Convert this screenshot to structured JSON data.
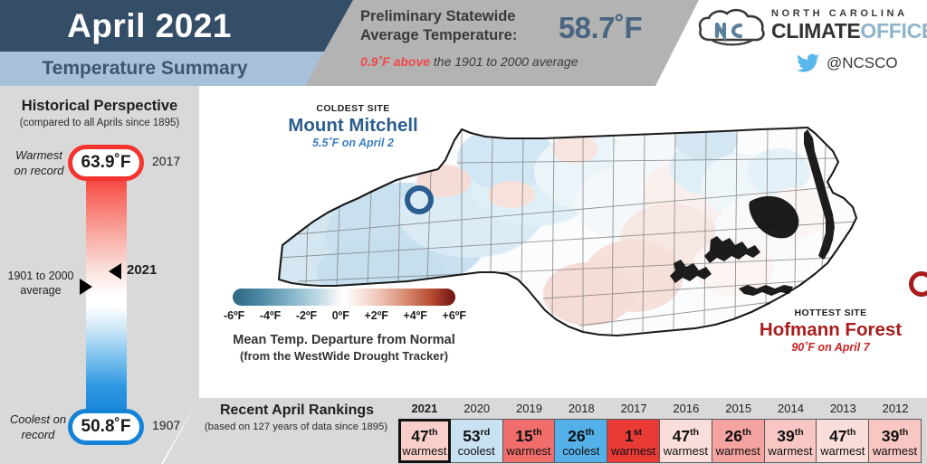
{
  "header": {
    "title": "April 2021",
    "subtitle": "Temperature Summary",
    "stat_label": "Preliminary Statewide Average Temperature:",
    "stat_value": "58.7˚F",
    "departure_value": "0.9˚F above",
    "departure_rest": " the 1901 to 2000 average"
  },
  "logo": {
    "org_line1": "NORTH CAROLINA",
    "org_part1": "CLIMATE",
    "org_part2": "OFFICE",
    "twitter_handle": "@NCSCO",
    "icon_cloud": "nc-cloud-logo-icon",
    "icon_twitter": "twitter-bird-icon"
  },
  "sidebar": {
    "title": "Historical Perspective",
    "subtitle": "(compared to all Aprils since 1895)",
    "warmest_label": "Warmest on record",
    "warmest_value": "63.9˚F",
    "warmest_year": "2017",
    "coolest_label": "Coolest on record",
    "coolest_value": "50.8˚F",
    "coolest_year": "1907",
    "average_label": "1901 to 2000 average",
    "current_marker": "2021",
    "hot_color": "#f4342f",
    "cold_color": "#1583d8"
  },
  "map": {
    "coldest_site": {
      "kind": "COLDEST SITE",
      "name": "Mount Mitchell",
      "value": "5.5˚F on April 2",
      "color": "#2b5e8e"
    },
    "hottest_site": {
      "kind": "HOTTEST SITE",
      "name": "Hofmann Forest",
      "value": "90˚F on April 7",
      "color": "#a81c1c"
    },
    "legend": {
      "ticks": [
        "-6ºF",
        "-4ºF",
        "-2ºF",
        "0ºF",
        "+2ºF",
        "+4ºF",
        "+6ºF"
      ],
      "caption_line1": "Mean Temp. Departure from Normal",
      "caption_line2": "(from the WestWide Drought Tracker)"
    }
  },
  "rankings": {
    "title": "Recent April Rankings",
    "subtitle": "(based on 127 years of data since 1895)",
    "items": [
      {
        "year": "2021",
        "rank": "47",
        "suffix": "th",
        "word": "warmest",
        "color": "#f9cfca",
        "current": true
      },
      {
        "year": "2020",
        "rank": "53",
        "suffix": "rd",
        "word": "coolest",
        "color": "#c9e2f2",
        "current": false
      },
      {
        "year": "2019",
        "rank": "15",
        "suffix": "th",
        "word": "warmest",
        "color": "#ef6e6c",
        "current": false
      },
      {
        "year": "2018",
        "rank": "26",
        "suffix": "th",
        "word": "coolest",
        "color": "#54b0e8",
        "current": false
      },
      {
        "year": "2017",
        "rank": "1",
        "suffix": "st",
        "word": "warmest",
        "color": "#ea3a36",
        "current": false
      },
      {
        "year": "2016",
        "rank": "47",
        "suffix": "th",
        "word": "warmest",
        "color": "#fadedb",
        "current": false
      },
      {
        "year": "2015",
        "rank": "26",
        "suffix": "th",
        "word": "warmest",
        "color": "#f4a3a0",
        "current": false
      },
      {
        "year": "2014",
        "rank": "39",
        "suffix": "th",
        "word": "warmest",
        "color": "#f8c7c3",
        "current": false
      },
      {
        "year": "2013",
        "rank": "47",
        "suffix": "th",
        "word": "warmest",
        "color": "#fadedb",
        "current": false
      },
      {
        "year": "2012",
        "rank": "39",
        "suffix": "th",
        "word": "warmest",
        "color": "#f8c7c3",
        "current": false
      }
    ]
  }
}
